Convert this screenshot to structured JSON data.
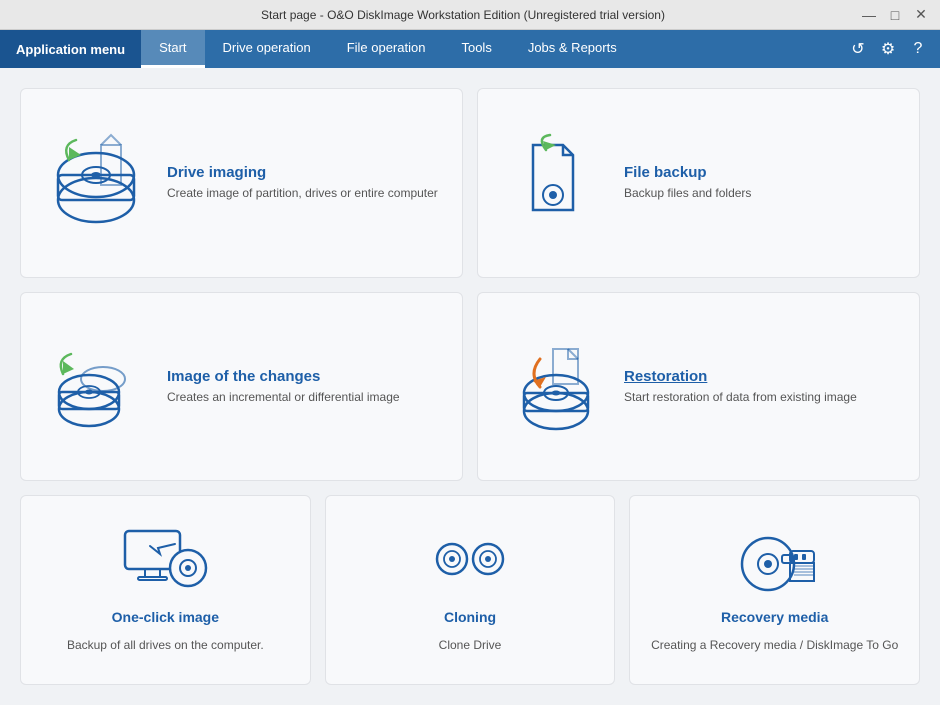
{
  "window": {
    "title": "Start page - O&O DiskImage Workstation Edition (Unregistered trial version)"
  },
  "titlebar": {
    "minimize": "—",
    "maximize": "□",
    "close": "✕"
  },
  "menubar": {
    "app_menu": "Application menu",
    "tabs": [
      {
        "label": "Start",
        "active": true
      },
      {
        "label": "Drive operation",
        "active": false
      },
      {
        "label": "File operation",
        "active": false
      },
      {
        "label": "Tools",
        "active": false
      },
      {
        "label": "Jobs & Reports",
        "active": false
      }
    ]
  },
  "cards": {
    "row1": [
      {
        "id": "drive-imaging",
        "title": "Drive imaging",
        "desc": "Create image of partition, drives or entire computer",
        "underline": false
      },
      {
        "id": "file-backup",
        "title": "File backup",
        "desc": "Backup files and folders",
        "underline": false
      }
    ],
    "row2": [
      {
        "id": "image-changes",
        "title": "Image of the changes",
        "desc": "Creates an incremental or differential image",
        "underline": false
      },
      {
        "id": "restoration",
        "title": "Restoration",
        "desc": "Start restoration of data from existing image",
        "underline": true
      }
    ],
    "row3": [
      {
        "id": "one-click-image",
        "title": "One-click image",
        "desc": "Backup of all drives on the computer."
      },
      {
        "id": "cloning",
        "title": "Cloning",
        "desc": "Clone Drive"
      },
      {
        "id": "recovery-media",
        "title": "Recovery media",
        "desc": "Creating a Recovery media / DiskImage To Go"
      }
    ]
  }
}
